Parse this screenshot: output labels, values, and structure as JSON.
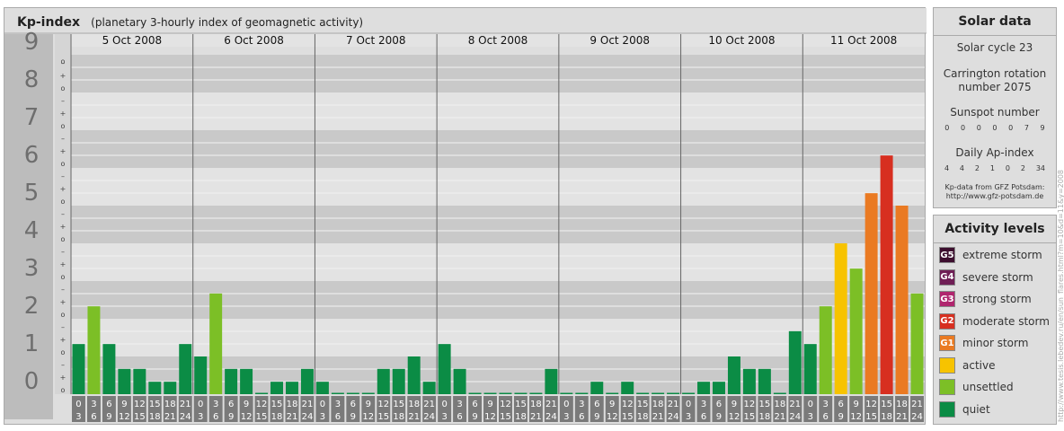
{
  "chart_data": {
    "type": "bar",
    "title": "Kp-index",
    "subtitle": "(planetary 3-hourly index of geomagnetic activity)",
    "ylim": [
      0,
      9
    ],
    "y_tick_labels": [
      "0",
      "1",
      "2",
      "3",
      "4",
      "5",
      "6",
      "7",
      "8",
      "9"
    ],
    "minor_tick_labels": [
      "–",
      "o",
      "+"
    ],
    "days": [
      "5 Oct 2008",
      "6 Oct 2008",
      "7 Oct 2008",
      "8 Oct 2008",
      "9 Oct 2008",
      "10 Oct 2008",
      "11 Oct 2008"
    ],
    "interval_start_labels": [
      "0",
      "3",
      "6",
      "9",
      "12",
      "15",
      "18",
      "21"
    ],
    "interval_end_labels": [
      "3",
      "6",
      "9",
      "12",
      "15",
      "18",
      "21",
      "24"
    ],
    "series": [
      {
        "values": [
          1.33,
          2.33,
          1.33,
          0.67,
          0.67,
          0.33,
          0.33,
          1.33,
          1.0,
          2.67,
          0.67,
          0.67,
          0.0,
          0.33,
          0.33,
          0.67,
          0.33,
          0.0,
          0.0,
          0.0,
          0.67,
          0.67,
          1.0,
          0.33,
          1.33,
          0.67,
          0.0,
          0.0,
          0.0,
          0.0,
          0.0,
          0.67,
          0.0,
          0.0,
          0.33,
          0.0,
          0.33,
          0.0,
          0.0,
          0.0,
          0.0,
          0.33,
          0.33,
          1.0,
          0.67,
          0.67,
          0.0,
          1.67,
          1.33,
          2.33,
          4.0,
          3.33,
          5.33,
          6.33,
          5.0,
          2.67
        ]
      }
    ],
    "colors": {
      "quiet": "#0b8c45",
      "unsettled": "#7cbf26",
      "active": "#f7c300",
      "minor": "#ea7a22",
      "moderate": "#d72f20",
      "strong": "#b0256e",
      "severe": "#6f1e55",
      "extreme": "#3d0f2f"
    }
  },
  "solar": {
    "title": "Solar data",
    "cycle": "Solar cycle 23",
    "carrington_line1": "Carrington rotation",
    "carrington_line2": "number 2075",
    "sunspot_label": "Sunspot number",
    "sunspot_values": [
      "0",
      "0",
      "0",
      "0",
      "0",
      "7",
      "9"
    ],
    "ap_label": "Daily Ap-index",
    "ap_values": [
      "4",
      "4",
      "2",
      "1",
      "0",
      "2",
      "34"
    ],
    "source_line1": "Kp-data from GFZ Potsdam:",
    "source_line2": "http://www.gfz-potsdam.de"
  },
  "activity": {
    "title": "Activity levels",
    "items": [
      {
        "badge": "G5",
        "label": "extreme storm",
        "color": "#3d0f2f"
      },
      {
        "badge": "G4",
        "label": "severe storm",
        "color": "#6f1e55"
      },
      {
        "badge": "G3",
        "label": "strong storm",
        "color": "#b0256e"
      },
      {
        "badge": "G2",
        "label": "moderate storm",
        "color": "#d72f20"
      },
      {
        "badge": "G1",
        "label": "minor storm",
        "color": "#ea7a22"
      },
      {
        "badge": "",
        "label": "active",
        "color": "#f7c300"
      },
      {
        "badge": "",
        "label": "unsettled",
        "color": "#7cbf26"
      },
      {
        "badge": "",
        "label": "quiet",
        "color": "#0b8c45"
      }
    ]
  },
  "watermark": "http://www.tesis.lebedev.ru/en/sun_flares.html?m=10&d=11&y=2008"
}
